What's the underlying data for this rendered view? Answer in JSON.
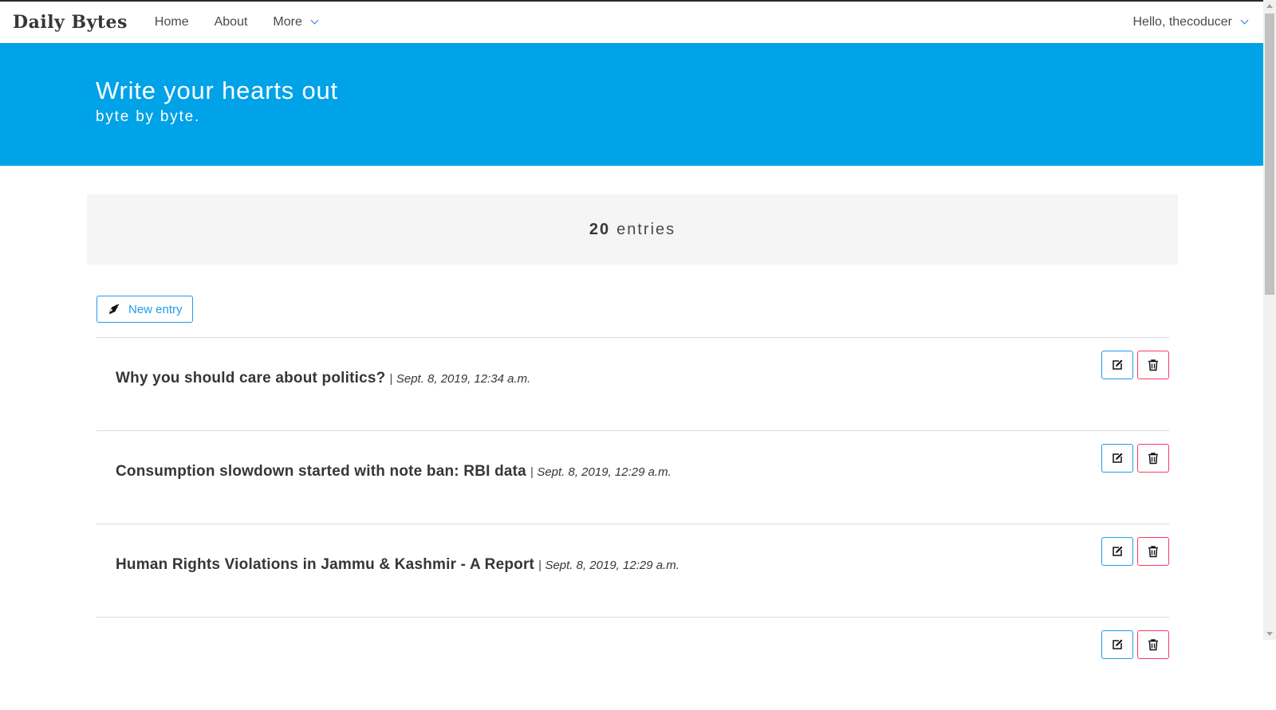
{
  "brand": "Daily Bytes",
  "nav": {
    "home": "Home",
    "about": "About",
    "more": "More",
    "user": "Hello, thecoducer"
  },
  "hero": {
    "title": "Write your hearts out",
    "subtitle": "byte by byte."
  },
  "entries": {
    "count": "20",
    "label": "entries"
  },
  "new_entry_label": "New entry",
  "posts": [
    {
      "title": "Why you should care about politics?",
      "date": "Sept. 8, 2019, 12:34 a.m."
    },
    {
      "title": "Consumption slowdown started with note ban: RBI data",
      "date": "Sept. 8, 2019, 12:29 a.m."
    },
    {
      "title": "Human Rights Violations in Jammu & Kashmir - A Report",
      "date": "Sept. 8, 2019, 12:29 a.m."
    },
    {
      "title": "",
      "date": ""
    }
  ],
  "separator": "|",
  "colors": {
    "hero_bg": "#00a2e8",
    "edit_border": "#209cee",
    "delete_border": "#ff3860",
    "accent": "#3273dc"
  },
  "icons": {
    "new_entry": "pen-icon",
    "edit": "edit-icon",
    "delete": "trash-icon",
    "dropdown": "chevron-down-icon"
  }
}
